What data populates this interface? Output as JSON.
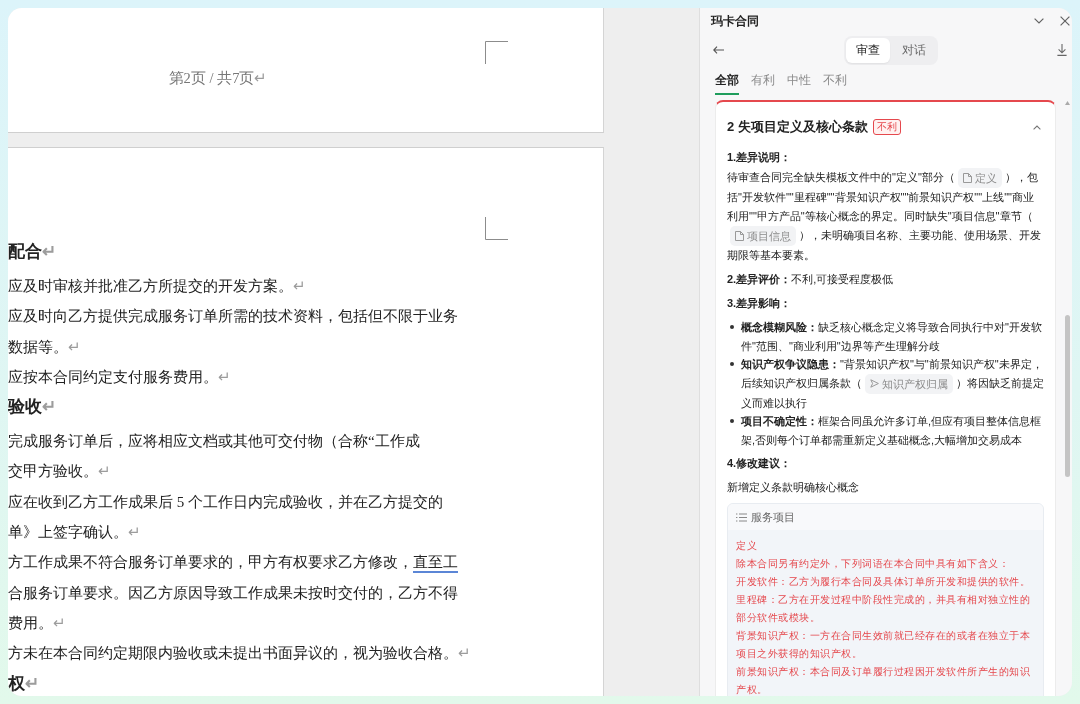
{
  "document": {
    "page_header": {
      "text": "第2页 / 共7页",
      "end_mark": "↵"
    },
    "paragraphs": [
      {
        "kind": "heading",
        "lines": [
          {
            "text": "配合"
          }
        ],
        "end_mark": "↵"
      },
      {
        "kind": "paragraph",
        "lines": [
          {
            "text": "应及时审核并批准乙方所提交的开发方案。"
          }
        ],
        "end_mark": "↵"
      },
      {
        "kind": "paragraph",
        "lines": [
          {
            "text": "应及时向乙方提供完成服务订单所需的技术资料，包括但不限于业务"
          },
          {
            "text": "数据等。"
          }
        ],
        "end_mark": "↵"
      },
      {
        "kind": "paragraph",
        "lines": [
          {
            "text": "应按本合同约定支付服务费用。"
          }
        ],
        "end_mark": "↵"
      },
      {
        "kind": "heading",
        "lines": [
          {
            "text": "验收"
          }
        ],
        "end_mark": "↵"
      },
      {
        "kind": "paragraph",
        "lines": [
          {
            "text": "完成服务订单后，应将相应文档或其他可交付物（合称“工作成"
          },
          {
            "text": "交甲方验收。"
          }
        ],
        "end_mark": "↵"
      },
      {
        "kind": "paragraph",
        "lines": [
          {
            "text": "应在收到乙方工作成果后 5 个工作日内完成验收，并在乙方提交的"
          },
          {
            "text": "单》上签字确认。"
          }
        ],
        "end_mark": "↵"
      },
      {
        "kind": "paragraph",
        "lines": [
          {
            "text": "方工作成果不符合服务订单要求的，甲方有权要求乙方修改，",
            "underlined": "直至工"
          },
          {
            "text": "合服务订单要求。因乙方原因导致工作成果未按时交付的，乙方不得"
          },
          {
            "text": "费用。"
          }
        ],
        "end_mark": "↵"
      },
      {
        "kind": "paragraph",
        "lines": [
          {
            "text": "方未在本合同约定期限内验收或未提出书面异议的，视为验收合格。"
          }
        ],
        "end_mark": "↵"
      },
      {
        "kind": "heading",
        "lines": [
          {
            "text": "权"
          }
        ],
        "end_mark": "↵"
      }
    ]
  },
  "panel": {
    "title": "玛卡合同",
    "view_tabs": [
      {
        "label": "审查",
        "selected": true
      },
      {
        "label": "对话",
        "selected": false
      }
    ],
    "filter_tabs": [
      {
        "label": "全部",
        "selected": true
      },
      {
        "label": "有利",
        "selected": false
      },
      {
        "label": "中性",
        "selected": false
      },
      {
        "label": "不利",
        "selected": false
      }
    ],
    "card": {
      "title": "2 失项目定义及核心条款",
      "tag": {
        "text": "不利",
        "kind": "unfavorable"
      },
      "expanded": true,
      "blocks": [
        {
          "kind": "heading",
          "text": "1.差异说明："
        },
        {
          "kind": "paragraph",
          "segments": [
            {
              "kind": "text",
              "text": "待审查合同完全缺失模板文件中的\"定义\"部分（"
            },
            {
              "kind": "doc_chip",
              "text": "定义"
            },
            {
              "kind": "text",
              "text": "），包括\"开发软件\"\"里程碑\"\"背景知识产权\"\"前景知识产权\"\"上线\"\"商业利用\"\"甲方产品\"等核心概念的界定。同时缺失\"项目信息\"章节（"
            },
            {
              "kind": "doc_chip",
              "text": "项目信息"
            },
            {
              "kind": "text",
              "text": "），未明确项目名称、主要功能、使用场景、开发期限等基本要素。"
            }
          ]
        },
        {
          "kind": "rich",
          "text": "**2.差异评价：**不利,可接受程度极低"
        },
        {
          "kind": "heading",
          "text": "3.差异影响："
        },
        {
          "kind": "bullets",
          "items": [
            {
              "segments": [
                {
                  "kind": "text",
                  "text": "**概念模糊风险：**缺乏核心概念定义将导致合同执行中对\"开发软件\"范围、\"商业利用\"边界等产生理解分歧"
                }
              ]
            },
            {
              "segments": [
                {
                  "kind": "text",
                  "text": "**知识产权争议隐患：**\"背景知识产权\"与\"前景知识产权\"未界定，后续知识产权归属条款（"
                },
                {
                  "kind": "clause_chip",
                  "text": "知识产权归属"
                },
                {
                  "kind": "text",
                  "text": "）将因缺乏前提定义而难以执行"
                }
              ]
            },
            {
              "segments": [
                {
                  "kind": "text",
                  "text": "**项目不确定性：**框架合同虽允许多订单,但应有项目整体信息框架,否则每个订单都需重新定义基础概念,大幅增加交易成本"
                }
              ]
            }
          ]
        },
        {
          "kind": "heading",
          "text": "4.修改建议："
        },
        {
          "kind": "rich",
          "text": "新增定义条款明确核心概念"
        },
        {
          "kind": "quote",
          "title": "服务项目",
          "lines": [
            "定义",
            "除本合同另有约定外，下列词语在本合同中具有如下含义：",
            "开发软件：乙方为履行本合同及具体订单所开发和提供的软件。",
            "里程碑：乙方在开发过程中阶段性完成的，并具有相对独立性的部分软件或模块。",
            "背景知识产权：一方在合同生效前就已经存在的或者在独立于本项目之外获得的知识产权。",
            "前景知识产权：本合同及订单履行过程因开发软件所产生的知识产权。"
          ]
        }
      ]
    }
  }
}
